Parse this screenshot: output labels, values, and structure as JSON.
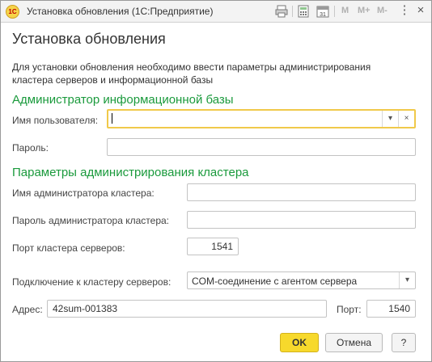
{
  "window": {
    "app_logo": "1С",
    "title": "Установка обновления  (1С:Предприятие)",
    "toolbar": {
      "icons": [
        "print-icon",
        "calculator-icon",
        "calendar-icon"
      ],
      "calendar_day": "31",
      "m_label": "M",
      "m_plus_label": "M+",
      "m_minus_label": "M-"
    },
    "controls": {
      "menu": "⋮",
      "close": "×"
    }
  },
  "form": {
    "heading": "Установка обновления",
    "description": "Для установки обновления необходимо ввести параметры администрирования кластера серверов и информационной базы",
    "ib_admin_section": "Администратор информационной базы",
    "username_label": "Имя пользователя:",
    "username_value": "",
    "password_label": "Пароль:",
    "password_value": "",
    "cluster_section": "Параметры администрирования кластера",
    "cluster_admin_label": "Имя администратора кластера:",
    "cluster_admin_value": "",
    "cluster_password_label": "Пароль администратора кластера:",
    "cluster_password_value": "",
    "cluster_port_label": "Порт кластера серверов:",
    "cluster_port_value": "1541",
    "connection_label": "Подключение к кластеру серверов:",
    "connection_value": "COM-соединение с агентом сервера",
    "address_label": "Адрес:",
    "address_value": "42sum-001383",
    "port_label": "Порт:",
    "port_value": "1540"
  },
  "buttons": {
    "ok": "OK",
    "cancel": "Отмена",
    "help": "?"
  },
  "colors": {
    "section": "#1a9a3c",
    "focus_border": "#f0c94a",
    "primary_button": "#f7d92c"
  }
}
